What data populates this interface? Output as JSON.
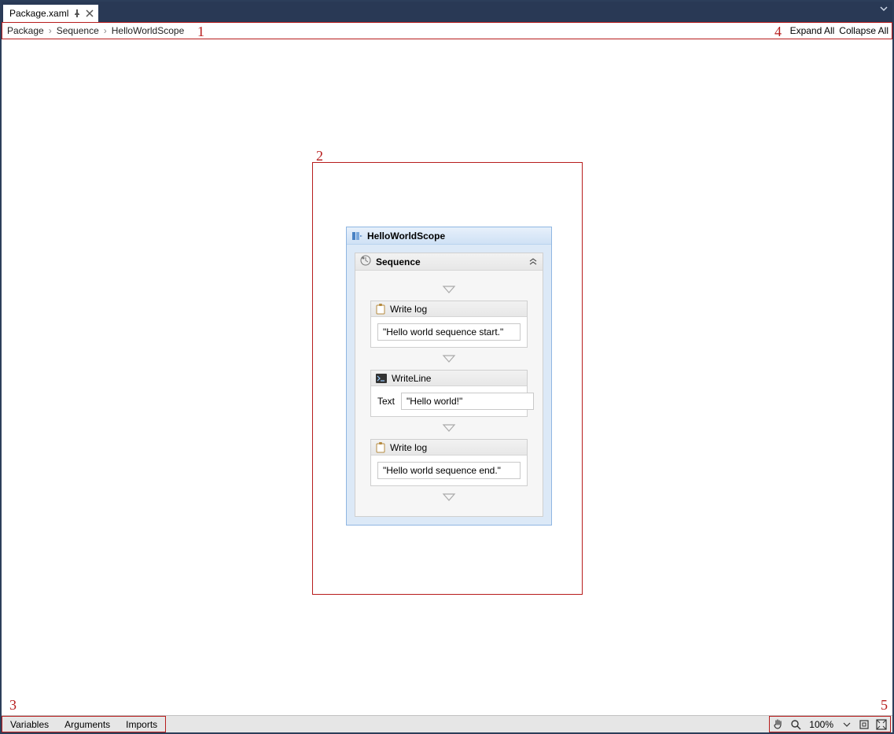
{
  "tab": {
    "title": "Package.xaml"
  },
  "breadcrumb": {
    "items": [
      "Package",
      "Sequence",
      "HelloWorldScope"
    ],
    "sep": "›"
  },
  "toolbar": {
    "expand_all": "Expand All",
    "collapse_all": "Collapse All"
  },
  "annotations": {
    "one": "1",
    "two": "2",
    "three": "3",
    "four": "4",
    "five": "5"
  },
  "workflow": {
    "scope_title": "HelloWorldScope",
    "sequence_title": "Sequence",
    "activities": [
      {
        "title": "Write log",
        "value": "\"Hello world sequence start.\"",
        "label": ""
      },
      {
        "title": "WriteLine",
        "value": "\"Hello world!\"",
        "label": "Text"
      },
      {
        "title": "Write log",
        "value": "\"Hello world sequence end.\"",
        "label": ""
      }
    ]
  },
  "bottom": {
    "tabs": [
      "Variables",
      "Arguments",
      "Imports"
    ],
    "zoom": "100%"
  }
}
